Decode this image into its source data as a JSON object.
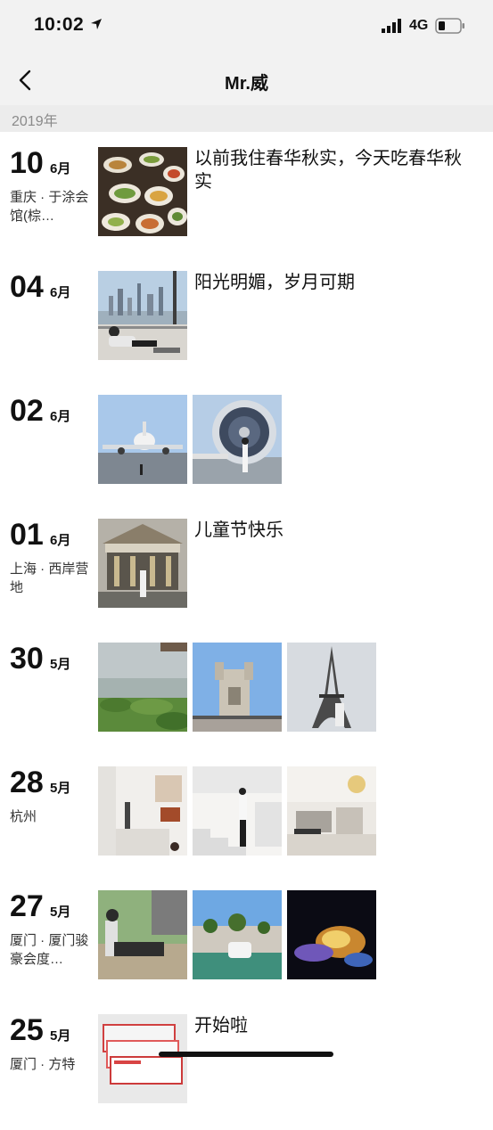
{
  "status": {
    "time": "10:02",
    "network": "4G"
  },
  "nav": {
    "title": "Mr.威"
  },
  "year": "2019年",
  "entries": [
    {
      "day": "10",
      "month": "6月",
      "location": "重庆 · 于涂会馆(棕…",
      "caption": "以前我住春华秋实，今天吃春华秋实",
      "photos": [
        "food-spread"
      ]
    },
    {
      "day": "04",
      "month": "6月",
      "location": "",
      "caption": "阳光明媚，岁月可期",
      "photos": [
        "city-skyline-lounge"
      ]
    },
    {
      "day": "02",
      "month": "6月",
      "location": "",
      "caption": "",
      "photos": [
        "airplane-tarmac",
        "jet-engine-pose"
      ]
    },
    {
      "day": "01",
      "month": "6月",
      "location": "上海 · 西岸营地",
      "caption": "儿童节快乐",
      "photos": [
        "carousel"
      ]
    },
    {
      "day": "30",
      "month": "5月",
      "location": "",
      "caption": "",
      "photos": [
        "lake-forest-view",
        "castle-tower",
        "eiffel-tower"
      ]
    },
    {
      "day": "28",
      "month": "5月",
      "location": "杭州",
      "caption": "",
      "photos": [
        "white-interior",
        "white-stairs-pose",
        "chandelier-room"
      ]
    },
    {
      "day": "27",
      "month": "5月",
      "location": "厦门 · 厦门骏豪会度…",
      "caption": "",
      "photos": [
        "pool-lounge",
        "resort-garden",
        "stage-lights"
      ]
    },
    {
      "day": "25",
      "month": "5月",
      "location": "厦门 · 方特",
      "caption": "开始啦",
      "photos": [
        "tickets"
      ]
    }
  ]
}
